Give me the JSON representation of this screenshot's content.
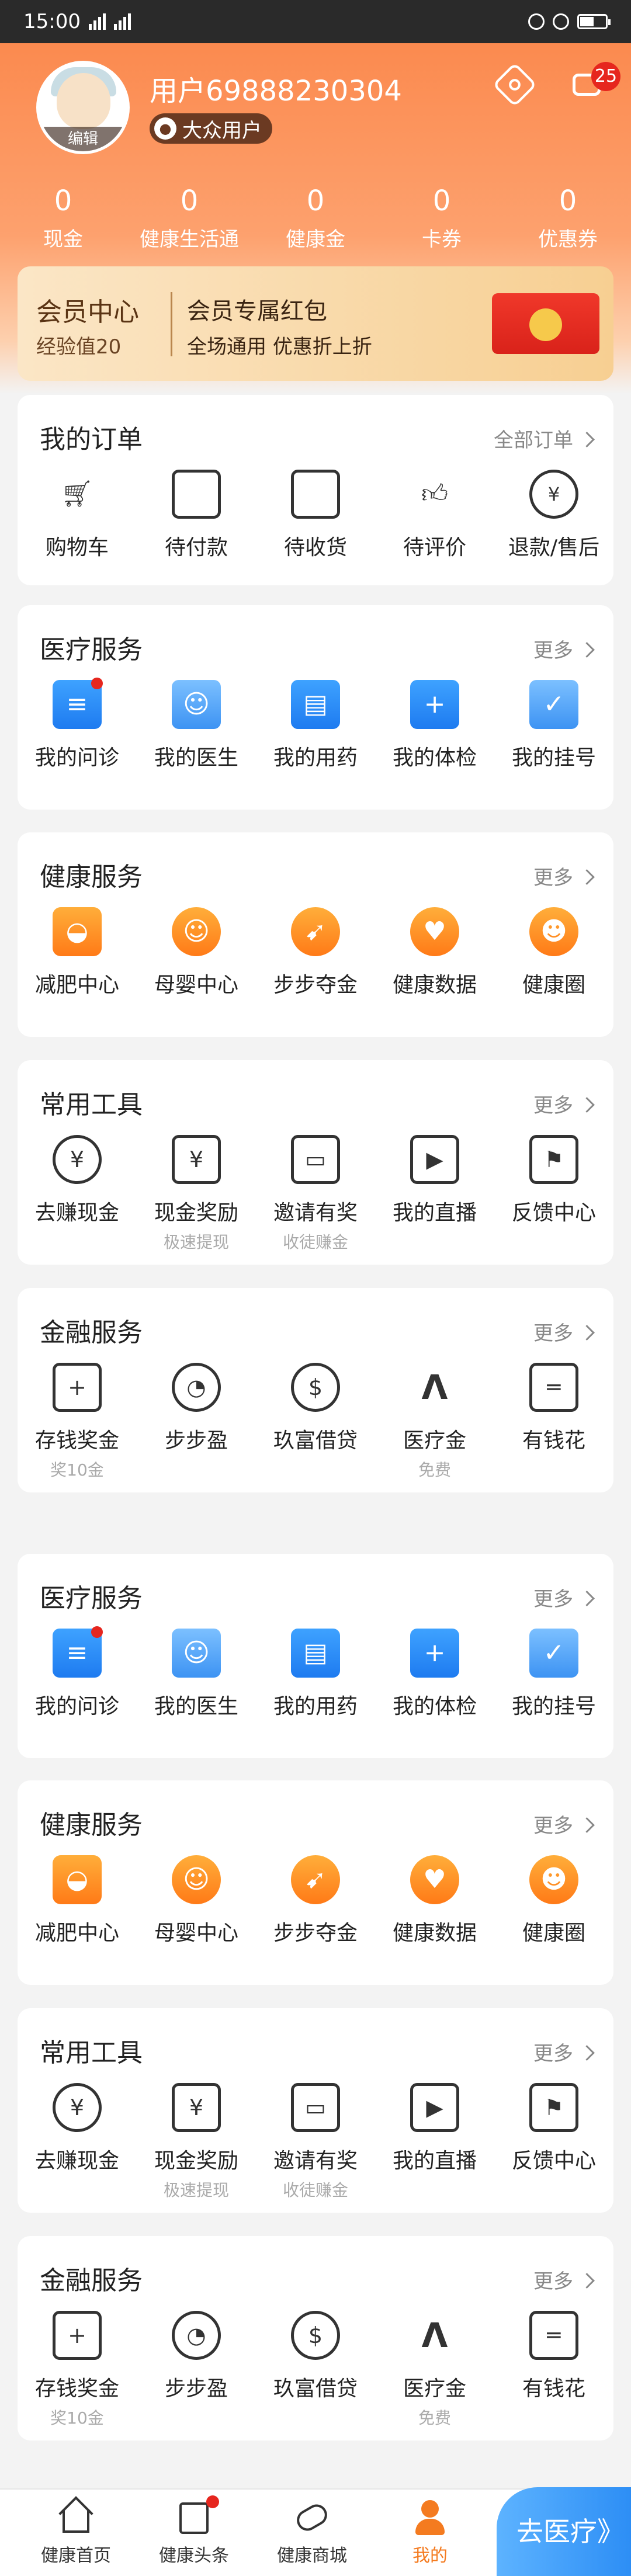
{
  "status_bar": {
    "time": "15:00"
  },
  "header": {
    "avatar_edit": "编辑",
    "user_name": "用户69888230304",
    "user_tag": "大众用户",
    "message_badge": "25",
    "stats": [
      {
        "value": "0",
        "label": "现金"
      },
      {
        "value": "0",
        "label": "健康生活通"
      },
      {
        "value": "0",
        "label": "健康金"
      },
      {
        "value": "0",
        "label": "卡券"
      },
      {
        "value": "0",
        "label": "优惠券"
      }
    ]
  },
  "member": {
    "title": "会员中心",
    "exp": "经验值20",
    "red_packet_title": "会员专属红包",
    "red_packet_sub": "全场通用 优惠折上折"
  },
  "orders": {
    "title": "我的订单",
    "more": "全部订单",
    "items": [
      "购物车",
      "待付款",
      "待收货",
      "待评价",
      "退款/售后"
    ]
  },
  "sections": [
    {
      "title": "医疗服务",
      "more": "更多",
      "items": [
        {
          "label": "我的问诊",
          "sub": ""
        },
        {
          "label": "我的医生",
          "sub": ""
        },
        {
          "label": "我的用药",
          "sub": ""
        },
        {
          "label": "我的体检",
          "sub": ""
        },
        {
          "label": "我的挂号",
          "sub": ""
        }
      ]
    },
    {
      "title": "健康服务",
      "more": "更多",
      "items": [
        {
          "label": "减肥中心",
          "sub": ""
        },
        {
          "label": "母婴中心",
          "sub": ""
        },
        {
          "label": "步步夺金",
          "sub": ""
        },
        {
          "label": "健康数据",
          "sub": ""
        },
        {
          "label": "健康圈",
          "sub": ""
        }
      ]
    },
    {
      "title": "常用工具",
      "more": "更多",
      "items": [
        {
          "label": "去赚现金",
          "sub": ""
        },
        {
          "label": "现金奖励",
          "sub": "极速提现"
        },
        {
          "label": "邀请有奖",
          "sub": "收徒赚金"
        },
        {
          "label": "我的直播",
          "sub": ""
        },
        {
          "label": "反馈中心",
          "sub": ""
        }
      ]
    },
    {
      "title": "金融服务",
      "more": "更多",
      "items": [
        {
          "label": "存钱奖金",
          "sub": "奖10金"
        },
        {
          "label": "步步盈",
          "sub": ""
        },
        {
          "label": "玖富借贷",
          "sub": ""
        },
        {
          "label": "医疗金",
          "sub": "免费"
        },
        {
          "label": "有钱花",
          "sub": ""
        }
      ]
    },
    {
      "title": "医疗服务",
      "more": "更多",
      "items": [
        {
          "label": "我的问诊",
          "sub": ""
        },
        {
          "label": "我的医生",
          "sub": ""
        },
        {
          "label": "我的用药",
          "sub": ""
        },
        {
          "label": "我的体检",
          "sub": ""
        },
        {
          "label": "我的挂号",
          "sub": ""
        }
      ]
    },
    {
      "title": "健康服务",
      "more": "更多",
      "items": [
        {
          "label": "减肥中心",
          "sub": ""
        },
        {
          "label": "母婴中心",
          "sub": ""
        },
        {
          "label": "步步夺金",
          "sub": ""
        },
        {
          "label": "健康数据",
          "sub": ""
        },
        {
          "label": "健康圈",
          "sub": ""
        }
      ]
    },
    {
      "title": "常用工具",
      "more": "更多",
      "items": [
        {
          "label": "去赚现金",
          "sub": ""
        },
        {
          "label": "现金奖励",
          "sub": "极速提现"
        },
        {
          "label": "邀请有奖",
          "sub": "收徒赚金"
        },
        {
          "label": "我的直播",
          "sub": ""
        },
        {
          "label": "反馈中心",
          "sub": ""
        }
      ]
    },
    {
      "title": "金融服务",
      "more": "更多",
      "items": [
        {
          "label": "存钱奖金",
          "sub": "奖10金"
        },
        {
          "label": "步步盈",
          "sub": ""
        },
        {
          "label": "玖富借贷",
          "sub": ""
        },
        {
          "label": "医疗金",
          "sub": "免费"
        },
        {
          "label": "有钱花",
          "sub": ""
        }
      ]
    }
  ],
  "bottom_nav": {
    "items": [
      "健康首页",
      "健康头条",
      "健康商城",
      "我的"
    ],
    "go_button": "去医疗》"
  },
  "colors": {
    "accent": "#f47b20",
    "badge": "#e6261e",
    "blue": "#2d8ef5"
  }
}
